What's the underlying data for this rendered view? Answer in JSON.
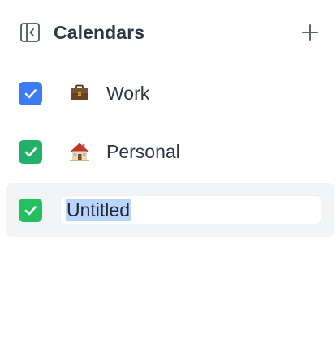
{
  "header": {
    "title": "Calendars",
    "collapse_icon": "sidebar-collapse-icon",
    "add_icon": "plus-icon"
  },
  "calendars": [
    {
      "name": "Work",
      "emoji": "briefcase-icon",
      "checked": true,
      "color": "#3b7cf4"
    },
    {
      "name": "Personal",
      "emoji": "house-icon",
      "checked": true,
      "color": "#22b16a"
    },
    {
      "name": "Untitled",
      "checked": true,
      "color": "#22c05f",
      "editing": true,
      "text_selected": true
    }
  ],
  "colors": {
    "title": "#2f3747",
    "row_hover": "#f3f4f6",
    "selection": "#b9d5fb"
  }
}
